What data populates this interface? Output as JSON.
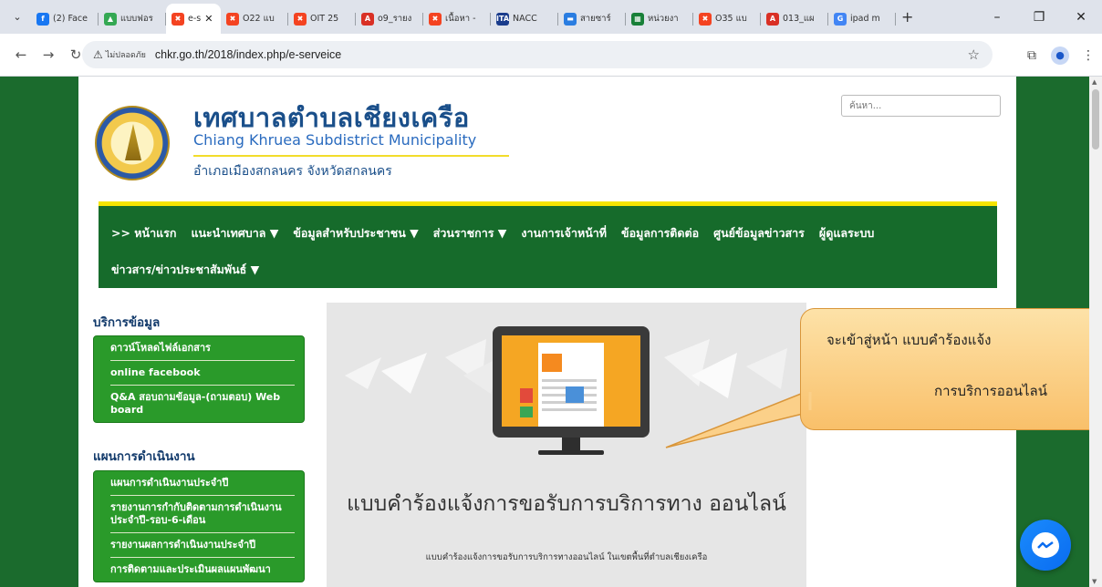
{
  "browser": {
    "tabs": [
      {
        "label": "(2) Face",
        "favicon": "facebook",
        "color": "#1877f2",
        "glyph": "f",
        "active": false
      },
      {
        "label": "แบบฟอร",
        "favicon": "google-drive",
        "color": "#34a853",
        "glyph": "▲",
        "active": false
      },
      {
        "label": "e-s",
        "favicon": "joomla",
        "color": "#f44321",
        "glyph": "✖",
        "active": true
      },
      {
        "label": "O22 แบ",
        "favicon": "joomla",
        "color": "#f44321",
        "glyph": "✖",
        "active": false
      },
      {
        "label": "OIT 25",
        "favicon": "joomla",
        "color": "#f44321",
        "glyph": "✖",
        "active": false
      },
      {
        "label": "o9_รายง",
        "favicon": "pdf",
        "color": "#d93025",
        "glyph": "A",
        "active": false
      },
      {
        "label": "เนื้อหา -",
        "favicon": "joomla",
        "color": "#f44321",
        "glyph": "✖",
        "active": false
      },
      {
        "label": "NACC",
        "favicon": "ita",
        "color": "#1a3c8c",
        "glyph": "ITA",
        "active": false
      },
      {
        "label": "สายซาร์",
        "favicon": "site",
        "color": "#2a7de1",
        "glyph": "▬",
        "active": false
      },
      {
        "label": "หน่วยงา",
        "favicon": "sheets",
        "color": "#188038",
        "glyph": "▦",
        "active": false
      },
      {
        "label": "O35 แบ",
        "favicon": "joomla",
        "color": "#f44321",
        "glyph": "✖",
        "active": false
      },
      {
        "label": "013_แผ",
        "favicon": "pdf",
        "color": "#d93025",
        "glyph": "A",
        "active": false
      },
      {
        "label": "ipad m",
        "favicon": "google",
        "color": "#4285f4",
        "glyph": "G",
        "active": false
      }
    ],
    "address": {
      "security_label": "ไม่ปลอดภัย",
      "url": "chkr.go.th/2018/index.php/e-serveice"
    }
  },
  "header": {
    "title": "เทศบาลตำบลเชียงเครือ",
    "subtitle": "Chiang Khruea Subdistrict Municipality",
    "location": "อำเภอเมืองสกลนคร จังหวัดสกลนคร",
    "search_placeholder": "ค้นหา..."
  },
  "nav": {
    "row1": [
      ">> หน้าแรก",
      "แนะนำเทศบาล ▼",
      "ข้อมูลสำหรับประชาชน ▼",
      "ส่วนราชการ ▼",
      "งานการเจ้าหน้าที่",
      "ข้อมูลการติดต่อ",
      "ศูนย์ข้อมูลข่าวสาร",
      "ผู้ดูแลระบบ"
    ],
    "row2": [
      "ข่าวสาร/ข่าวประชาสัมพันธ์ ▼"
    ]
  },
  "sidebar": {
    "sections": [
      {
        "heading": "บริการข้อมูล",
        "items": [
          "ดาวน์โหลดไฟล์เอกสาร",
          "online facebook",
          "Q&A สอบถามข้อมูล-(ถามตอบ) Web board"
        ]
      },
      {
        "heading": "แผนการดำเนินงาน",
        "items": [
          "แผนการดำเนินงานประจำปี",
          "รายงานการกำกับติดตามการดำเนินงานประจำปี-รอบ-6-เดือน",
          "รายงานผลการดำเนินงานประจำปี",
          "การติดตามและประเมินผลแผนพัฒนา"
        ]
      }
    ]
  },
  "banner": {
    "title": "แบบคำร้องแจ้งการขอรับการบริการทาง ออนไลน์",
    "description": "แบบคำร้องแจ้งการขอรับการบริการทางออนไลน์ ในเขตพื้นที่ตำบลเชียงเครือ"
  },
  "callout": {
    "line1": "จะเข้าสู่หน้า แบบคำร้องแจ้ง",
    "line2": "การบริการออนไลน์"
  }
}
